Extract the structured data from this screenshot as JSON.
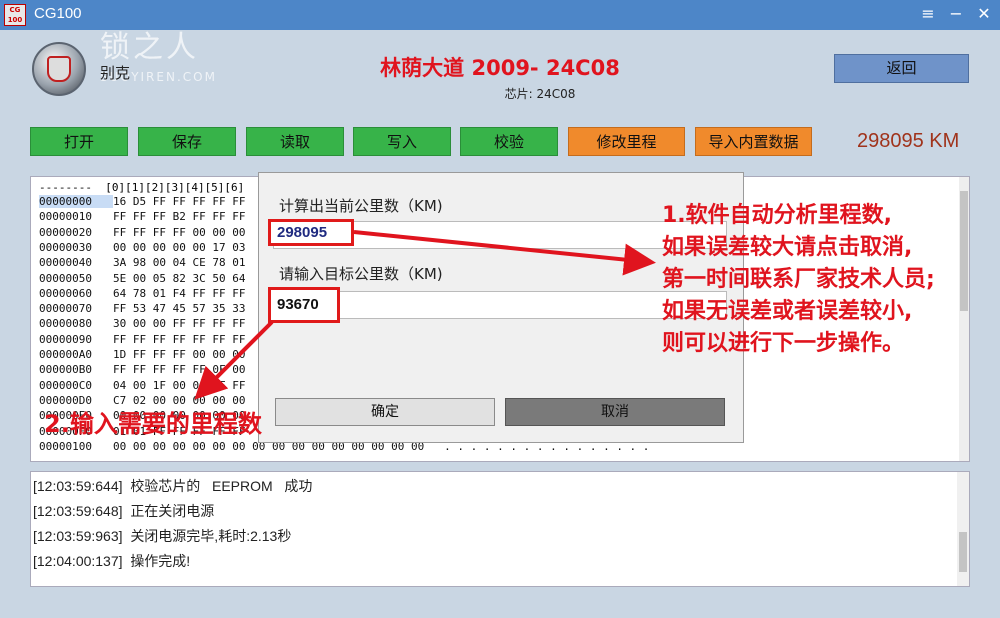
{
  "window": {
    "title": "CG100",
    "app_icon_text": "CG 100",
    "menu_glyph": "≡",
    "minimize_glyph": "−",
    "close_glyph": "✕"
  },
  "header": {
    "brand": "别克",
    "watermark": "锁之人",
    "watermark_sub": "SUOYIREN.COM",
    "model": "林荫大道  2009-  24C08",
    "chip": "芯片: 24C08",
    "back_label": "返回"
  },
  "toolbar": {
    "open": "打开",
    "save": "保存",
    "read": "读取",
    "write": "写入",
    "verify": "校验",
    "edit_mileage": "修改里程",
    "import_data": "导入内置数据",
    "mileage_display": "298095 KM"
  },
  "hex": {
    "header": "--------  [0][1][2][3][4][5][6]",
    "rows": [
      {
        "addr": "00000000",
        "bytes": "16 D5 FF FF FF FF FF"
      },
      {
        "addr": "00000010",
        "bytes": "FF FF FF B2 FF FF FF"
      },
      {
        "addr": "00000020",
        "bytes": "FF FF FF FF 00 00 00"
      },
      {
        "addr": "00000030",
        "bytes": "00 00 00 00 00 17 03"
      },
      {
        "addr": "00000040",
        "bytes": "3A 98 00 04 CE 78 01"
      },
      {
        "addr": "00000050",
        "bytes": "5E 00 05 82 3C 50 64"
      },
      {
        "addr": "00000060",
        "bytes": "64 78 01 F4 FF FF FF"
      },
      {
        "addr": "00000070",
        "bytes": "FF 53 47 45 57 35 33"
      },
      {
        "addr": "00000080",
        "bytes": "30 00 00 FF FF FF FF"
      },
      {
        "addr": "00000090",
        "bytes": "FF FF FF FF FF FF FF"
      },
      {
        "addr": "000000A0",
        "bytes": "1D FF FF FF 00 00 00"
      },
      {
        "addr": "000000B0",
        "bytes": "FF FF FF FF FF 0F 00"
      },
      {
        "addr": "000000C0",
        "bytes": "04 00 1F 00 01 FF FF"
      },
      {
        "addr": "000000D0",
        "bytes": "C7 02 00 00 00 00 00"
      },
      {
        "addr": "000000E0",
        "bytes": "00 00 00 00 00 00 00"
      },
      {
        "addr": "000000F0",
        "bytes": "01 01 FF FF FF FF FF"
      },
      {
        "addr": "00000100",
        "bytes": "00 00 00 00 00 00 00 00 00 00 00 00 00 00 00 00   . . . . . . . . . . . . . . . ."
      }
    ]
  },
  "dialog": {
    "current_label": "计算出当前公里数（KM)",
    "current_value": "298095",
    "target_label": "请输入目标公里数（KM)",
    "target_value": "93670",
    "ok_label": "确定",
    "cancel_label": "取消"
  },
  "annotations": {
    "note1": [
      "1.软件自动分析里程数,",
      "如果误差较大请点击取消,",
      "第一时间联系厂家技术人员;",
      "如果无误差或者误差较小,",
      "则可以进行下一步操作。"
    ],
    "note2": "2.输入需要的里程数"
  },
  "log": [
    {
      "time": "[12:03:59:644]",
      "msg": "校验芯片的   EEPROM   成功"
    },
    {
      "time": "[12:03:59:648]",
      "msg": "正在关闭电源"
    },
    {
      "time": "[12:03:59:963]",
      "msg": "关闭电源完毕,耗时:2.13秒"
    },
    {
      "time": "[12:04:00:137]",
      "msg": "操作完成!"
    }
  ],
  "colors": {
    "titlebar": "#4d86c8",
    "background": "#c9d6e3",
    "toolbar_green": "#37b349",
    "toolbar_orange": "#f08a2c",
    "annotation_red": "#e0141e"
  }
}
